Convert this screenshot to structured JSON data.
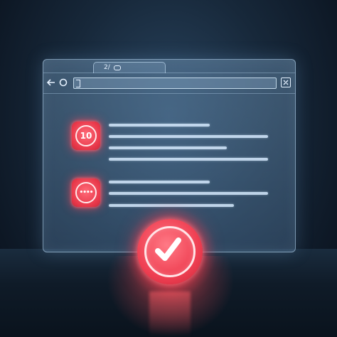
{
  "browser": {
    "tab": {
      "label": "2/",
      "icon": "link-icon"
    },
    "addressbar": {
      "back_icon": "back-arrow-icon",
      "reload_icon": "reload-icon",
      "url_value": "",
      "extension_icon": "extension-icon"
    }
  },
  "content": {
    "items": [
      {
        "badge_text": "10",
        "icon": "number-badge-icon"
      },
      {
        "badge_text": "••••",
        "icon": "more-dots-icon"
      }
    ]
  },
  "status": {
    "icon": "checkmark-icon",
    "state": "success"
  },
  "colors": {
    "accent": "#ef3f52",
    "panel": "#6f9cc4",
    "background": "#10202f",
    "text_lines": "#d7ebff"
  }
}
